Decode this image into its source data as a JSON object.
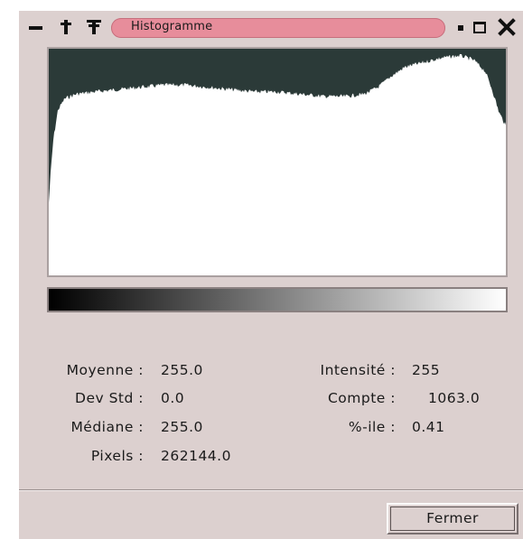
{
  "window": {
    "title": "Histogramme"
  },
  "histogram": {
    "min_intensity": 0,
    "max_intensity": 255,
    "fill_color": "#ffffff",
    "background_color": "#2b3a38"
  },
  "stats": {
    "mean_label": "Moyenne :",
    "mean_value": "255.0",
    "stddev_label": "Dev Std :",
    "stddev_value": "0.0",
    "median_label": "Médiane :",
    "median_value": "255.0",
    "pixels_label": "Pixels :",
    "pixels_value": "262144.0",
    "intensity_label": "Intensité :",
    "intensity_value": "255",
    "count_label": "Compte :",
    "count_value": "1063.0",
    "percentile_label": "%-ile :",
    "percentile_value": "0.41"
  },
  "buttons": {
    "close_label": "Fermer"
  },
  "colors": {
    "window_bg": "#dcd0cf",
    "title_pill": "#e78d9b"
  }
}
